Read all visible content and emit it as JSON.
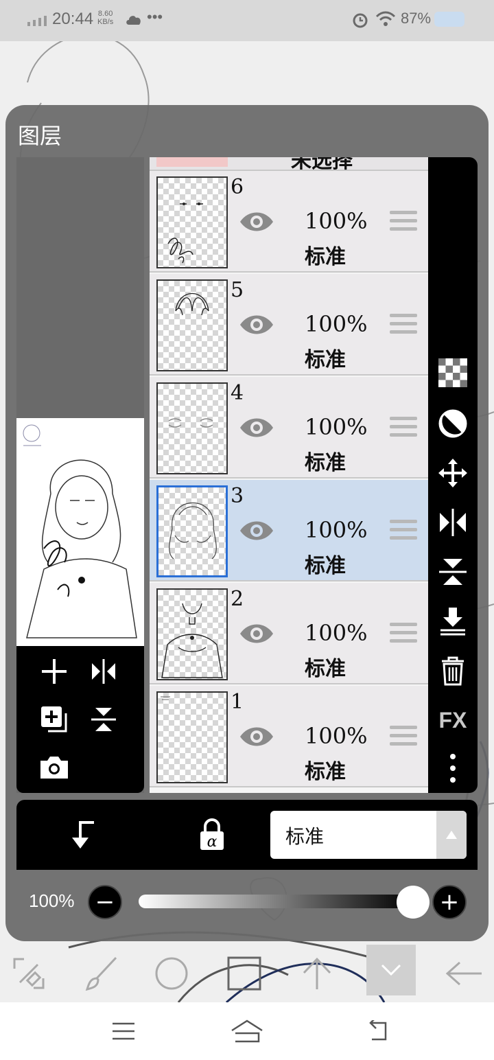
{
  "status_bar": {
    "time": "20:44",
    "network_speed_value": "8.60",
    "network_speed_unit": "KB/s",
    "battery": "87%"
  },
  "layer_panel": {
    "title": "图层",
    "top_partial_label": "未选择",
    "layers": [
      {
        "number": "6",
        "opacity": "100%",
        "blend": "标准",
        "selected": false
      },
      {
        "number": "5",
        "opacity": "100%",
        "blend": "标准",
        "selected": false
      },
      {
        "number": "4",
        "opacity": "100%",
        "blend": "标准",
        "selected": false
      },
      {
        "number": "3",
        "opacity": "100%",
        "blend": "标准",
        "selected": true
      },
      {
        "number": "2",
        "opacity": "100%",
        "blend": "标准",
        "selected": false
      },
      {
        "number": "1",
        "opacity": "100%",
        "blend": "标准",
        "selected": false
      }
    ],
    "blend_mode": "标准",
    "opacity_label": "100%",
    "opacity_value": 1.0,
    "side_tools": [
      "transparency-icon",
      "contrast-icon",
      "move-icon",
      "flip-horizontal-icon",
      "flip-vertical-icon",
      "merge-down-icon",
      "trash-icon",
      "fx-icon",
      "more-icon"
    ],
    "side_fx_label": "FX"
  },
  "colors": {
    "selected_row": "#cddcee",
    "selected_border": "#2a6fd6",
    "panel_bg": "#696969"
  }
}
